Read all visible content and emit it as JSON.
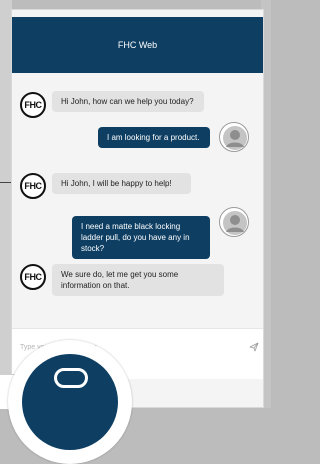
{
  "header": {
    "title": "FHC Web"
  },
  "bot": {
    "logo_text": "FHC"
  },
  "messages": [
    {
      "sender": "bot",
      "text": "Hi John, how can we help you today?"
    },
    {
      "sender": "user",
      "text": "I am looking for a product."
    },
    {
      "sender": "bot",
      "text": "Hi John, I will be happy to help!"
    },
    {
      "sender": "user",
      "text": "I need a matte black locking ladder pull, do you have any in stock?"
    },
    {
      "sender": "bot",
      "text": "We sure do, let me get you some information on that."
    }
  ],
  "input": {
    "placeholder": "Type your message here",
    "value": ""
  },
  "icons": {
    "send": "send-icon",
    "avatar": "user-avatar-icon",
    "launcher": "chat-launcher-icon"
  },
  "colors": {
    "brand": "#0e3f63",
    "bot_bubble": "#e2e2e2",
    "background": "#f4f4f4"
  }
}
